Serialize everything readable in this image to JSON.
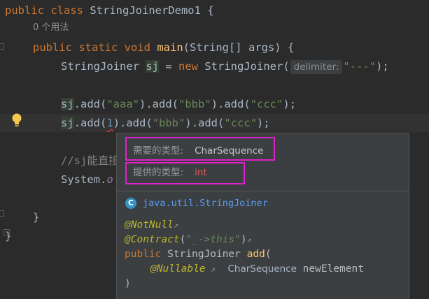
{
  "code": {
    "line1": {
      "kw": "public class",
      "name": "StringJoinerDemo1",
      "rest": " {"
    },
    "usages": "0 个用法",
    "line2": {
      "kw1": "public static void",
      "fn": "main",
      "rest": "(String[] args) {"
    },
    "line3": {
      "type": "StringJoiner",
      "var": "sj",
      "eq": " = ",
      "kw": "new",
      "ctor": " StringJoiner(",
      "hint": "delimiter:",
      "str": "\"---\"",
      "end": ");"
    },
    "line4": {
      "var": "sj",
      "p1": ".add(",
      "s1": "\"aaa\"",
      "p2": ").add(",
      "s2": "\"bbb\"",
      "p3": ").add(",
      "s3": "\"ccc\"",
      "end": ");"
    },
    "line5": {
      "var": "sj",
      "p1": ".add(",
      "n1": "1",
      "p2": ").add(",
      "s2": "\"bbb\"",
      "p3": ").add(",
      "s3": "\"ccc\"",
      "end": ");"
    },
    "line6": {
      "comment": "//sj能直接"
    },
    "line7": {
      "sys": "System.",
      "out": "o"
    },
    "close1": "}",
    "close2": "}"
  },
  "popup": {
    "required_label": "需要的类型:",
    "required_value": "CharSequence",
    "provided_label": "提供的类型:",
    "provided_value": "int",
    "class_icon": "C",
    "class_name": "java.util.StringJoiner",
    "doc": {
      "ann1": "@NotNull",
      "ann2": "@Contract",
      "ann2_arg": "\"_->this\"",
      "kw": "public",
      "ret": "StringJoiner",
      "method": "add",
      "param_ann": "@Nullable",
      "param_type": "CharSequence",
      "param_name": "newElement",
      "close": ")"
    }
  },
  "colors": {
    "accent_box": "#e020c8",
    "error": "#e05a5a",
    "link": "#589df6"
  }
}
